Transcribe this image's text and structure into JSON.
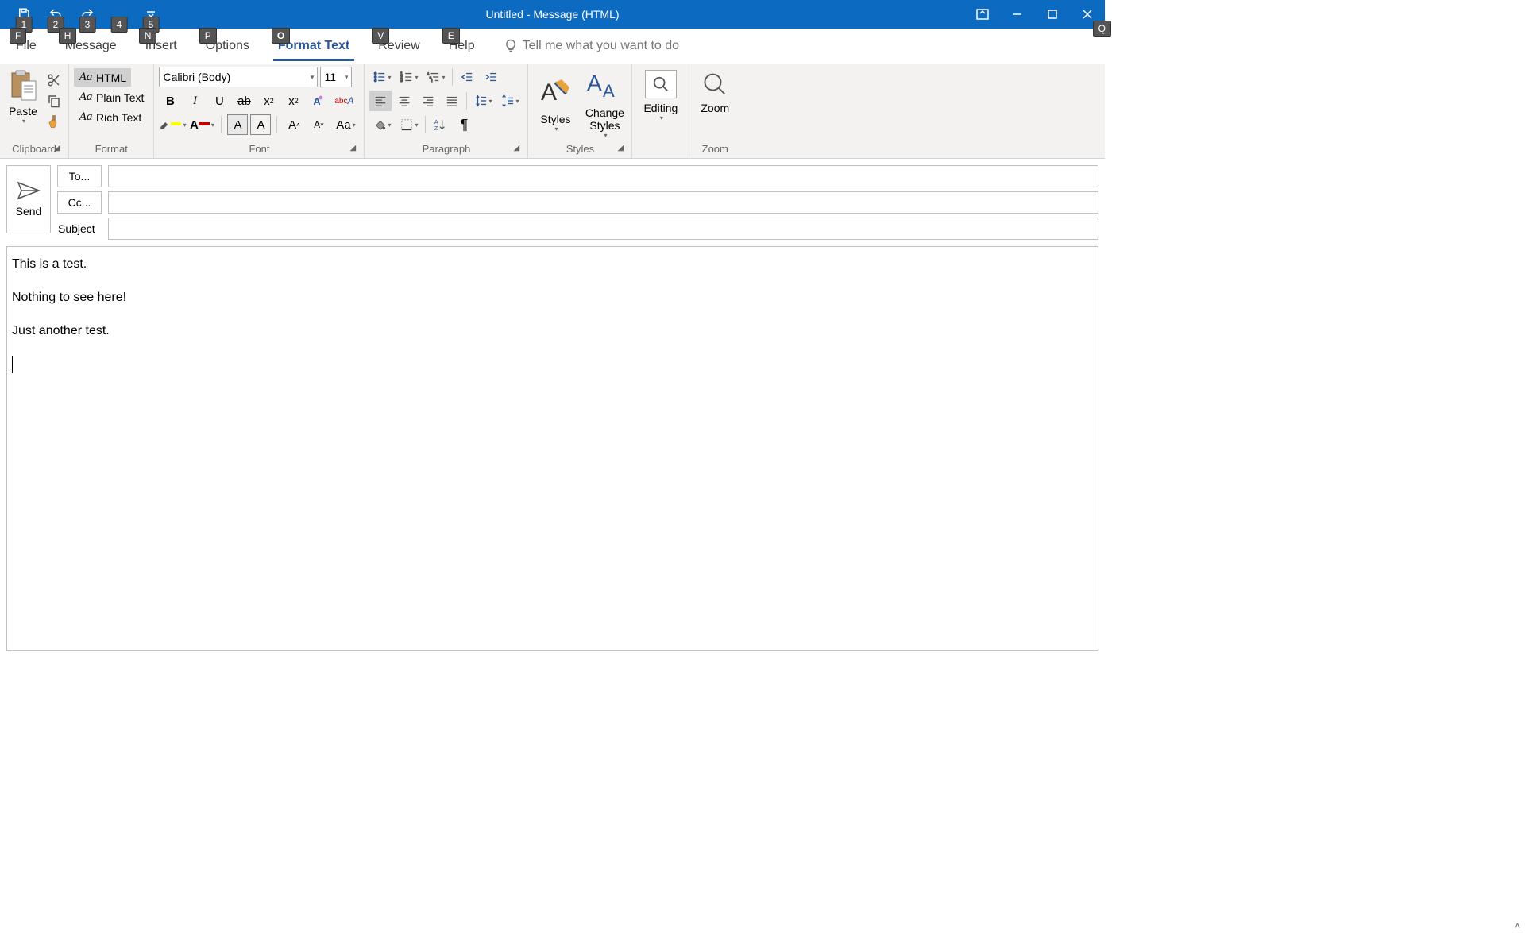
{
  "title": "Untitled  -  Message (HTML)",
  "qat_keys": [
    "1",
    "2",
    "3",
    "4",
    "5"
  ],
  "tabs": {
    "file": "File",
    "message": "Message",
    "insert": "Insert",
    "options": "Options",
    "format_text": "Format Text",
    "review": "Review",
    "help": "Help"
  },
  "tab_keys": {
    "file": "F",
    "message": "H",
    "insert": "N",
    "options": "P",
    "format_text": "O",
    "review": "V",
    "help": "E",
    "tellme": "Q"
  },
  "tell_me_placeholder": "Tell me what you want to do",
  "ribbon": {
    "clipboard": {
      "label": "Clipboard",
      "paste": "Paste"
    },
    "format": {
      "label": "Format",
      "html": "HTML",
      "plain": "Plain Text",
      "rich": "Rich Text",
      "aa": "Aa"
    },
    "font": {
      "label": "Font",
      "name": "Calibri (Body)",
      "size": "11",
      "aa_upper": "Aa"
    },
    "paragraph": {
      "label": "Paragraph"
    },
    "styles": {
      "label": "Styles",
      "styles": "Styles",
      "change": "Change Styles"
    },
    "editing": {
      "label": "Editing"
    },
    "zoom": {
      "label": "Zoom",
      "btn": "Zoom"
    }
  },
  "compose": {
    "send": "Send",
    "to": "To...",
    "cc": "Cc...",
    "subject": "Subject",
    "body": [
      "This is a test.",
      "Nothing to see here!",
      "Just another test."
    ]
  }
}
